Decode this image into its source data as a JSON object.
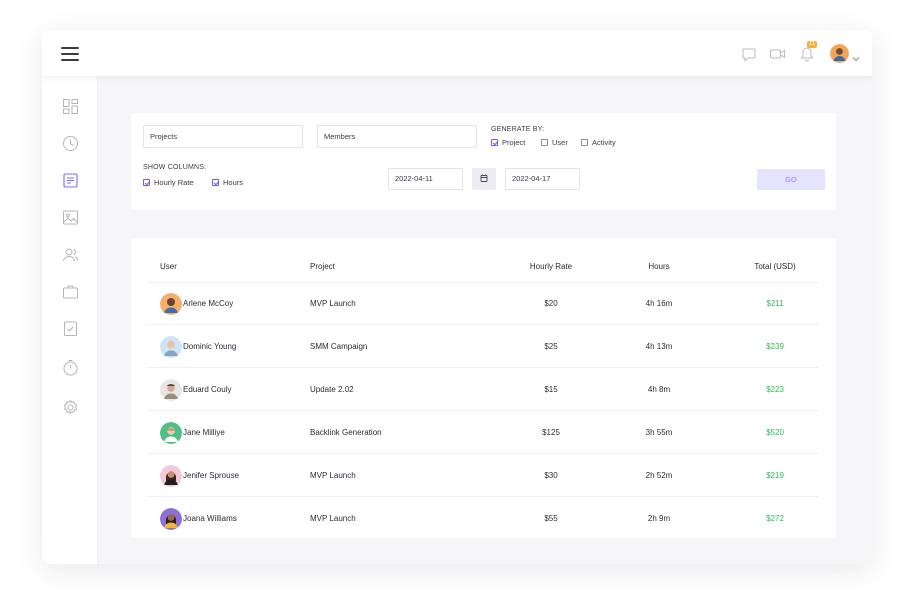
{
  "topbar": {
    "notification_count": "11",
    "icons": [
      "menu-icon",
      "chat-icon",
      "video-icon",
      "bell-icon",
      "user-avatar",
      "chevron-down-icon"
    ]
  },
  "sidebar": {
    "icons": [
      "dashboard-icon",
      "clock-icon",
      "report-icon",
      "image-icon",
      "users-icon",
      "briefcase-icon",
      "checklist-icon",
      "timer-icon",
      "gear-icon"
    ]
  },
  "filters": {
    "projects_value": "Projects",
    "members_value": "Members",
    "generate_by_label": "GENERATE BY:",
    "generate_options": [
      {
        "label": "Project",
        "checked": true
      },
      {
        "label": "User",
        "checked": false
      },
      {
        "label": "Activity",
        "checked": false
      }
    ],
    "show_columns_label": "SHOW COLUMNS:",
    "column_options": [
      {
        "label": "Hourly Rate",
        "checked": true
      },
      {
        "label": "Hours",
        "checked": true
      }
    ],
    "date_from": "2022-04-11",
    "date_to": "2022-04-17",
    "go_label": "GO"
  },
  "table": {
    "headers": {
      "user": "User",
      "project": "Project",
      "hourly_rate": "Hourly Rate",
      "hours": "Hours",
      "total": "Total (USD)"
    },
    "rows": [
      {
        "user": "Arlene McCoy",
        "project": "MVP Launch",
        "rate": "$20",
        "hours": "4h 16m",
        "total": "$211"
      },
      {
        "user": "Dominic Young",
        "project": "SMM Campaign",
        "rate": "$25",
        "hours": "4h 13m",
        "total": "$239"
      },
      {
        "user": "Eduard Couly",
        "project": "Update 2.02",
        "rate": "$15",
        "hours": "4h 8m",
        "total": "$223"
      },
      {
        "user": "Jane Milliye",
        "project": "Backlink Generation",
        "rate": "$125",
        "hours": "3h 55m",
        "total": "$520"
      },
      {
        "user": "Jenifer Sprouse",
        "project": "MVP Launch",
        "rate": "$30",
        "hours": "2h 52m",
        "total": "$219"
      },
      {
        "user": "Joana Williams",
        "project": "MVP Launch",
        "rate": "$55",
        "hours": "2h 9m",
        "total": "$272"
      }
    ]
  },
  "colors": {
    "accent": "#6a5cf6",
    "total_green": "#2fba5a",
    "go_button_bg": "#e5e3fd",
    "badge": "#f6b13a"
  }
}
